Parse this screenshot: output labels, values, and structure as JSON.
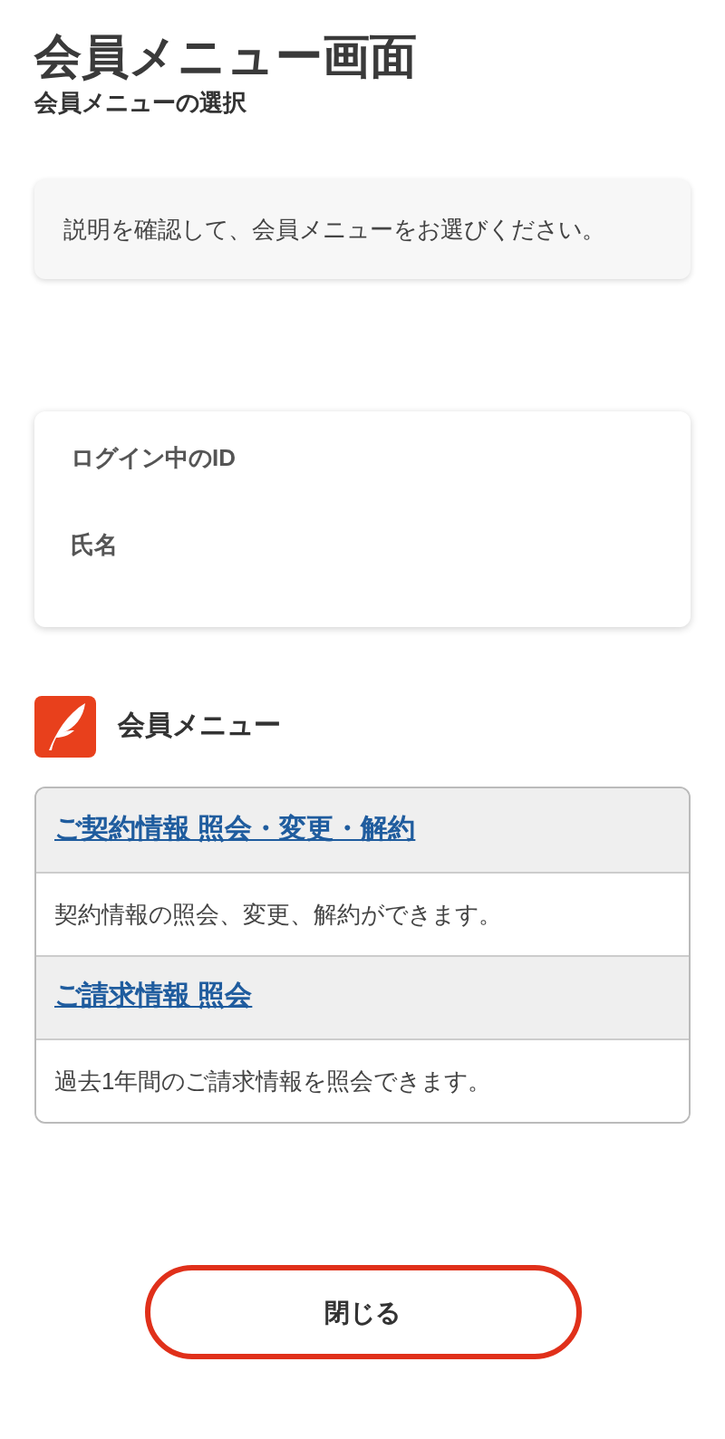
{
  "header": {
    "title": "会員メニュー画面",
    "subtitle": "会員メニューの選択"
  },
  "notice": "説明を確認して、会員メニューをお選びください。",
  "account": {
    "fields": [
      "ログイン中のID",
      "氏名"
    ]
  },
  "menu": {
    "title": "会員メニュー",
    "items": [
      {
        "link": "ご契約情報 照会・変更・解約",
        "description": "契約情報の照会、変更、解約ができます。"
      },
      {
        "link": "ご請求情報 照会",
        "description": "過去1年間のご請求情報を照会できます。"
      }
    ]
  },
  "close_button": "閉じる"
}
